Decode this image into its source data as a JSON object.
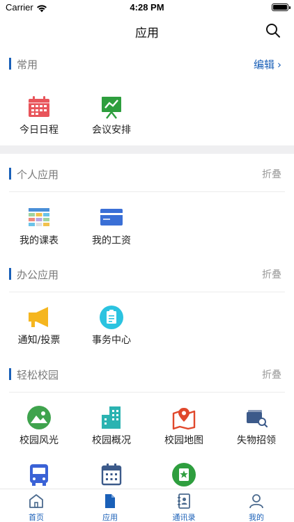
{
  "status_bar": {
    "carrier": "Carrier",
    "time": "4:28 PM"
  },
  "nav": {
    "title": "应用"
  },
  "sections": {
    "common": {
      "title": "常用",
      "action": "编辑",
      "chevron": "›"
    },
    "personal": {
      "title": "个人应用",
      "action": "折叠"
    },
    "office": {
      "title": "办公应用",
      "action": "折叠"
    },
    "campus": {
      "title": "轻松校园",
      "action": "折叠"
    }
  },
  "apps": {
    "common": [
      {
        "label": "今日日程",
        "icon": "calendar-grid-icon",
        "color": "#e8545a"
      },
      {
        "label": "会议安排",
        "icon": "presentation-board-icon",
        "color": "#2e9e3e"
      }
    ],
    "personal": [
      {
        "label": "我的课表",
        "icon": "timetable-icon",
        "color": "#4a8fd8"
      },
      {
        "label": "我的工资",
        "icon": "payslip-card-icon",
        "color": "#3a6fd6"
      }
    ],
    "office": [
      {
        "label": "通知/投票",
        "icon": "megaphone-icon",
        "color": "#f5b61f"
      },
      {
        "label": "事务中心",
        "icon": "clipboard-icon",
        "color": "#2bc3e0"
      }
    ],
    "campus": [
      {
        "label": "校园风光",
        "icon": "landscape-icon",
        "color": "#3fa34d"
      },
      {
        "label": "校园概况",
        "icon": "buildings-icon",
        "color": "#2bb3b1"
      },
      {
        "label": "校园地图",
        "icon": "map-pin-icon",
        "color": "#e0482c"
      },
      {
        "label": "失物招领",
        "icon": "wallet-search-icon",
        "color": "#3c5a8a"
      }
    ],
    "more": [
      {
        "icon": "bus-icon",
        "color": "#3a62d6"
      },
      {
        "icon": "calendar-icon",
        "color": "#3c5a8a"
      },
      {
        "icon": "star-badge-icon",
        "color": "#2e9e3e"
      }
    ]
  },
  "tabbar": {
    "accent": "#1a60b8",
    "items": [
      {
        "label": "首页",
        "icon": "home-icon"
      },
      {
        "label": "应用",
        "icon": "document-icon"
      },
      {
        "label": "通讯录",
        "icon": "contacts-book-icon"
      },
      {
        "label": "我的",
        "icon": "person-icon"
      }
    ]
  }
}
